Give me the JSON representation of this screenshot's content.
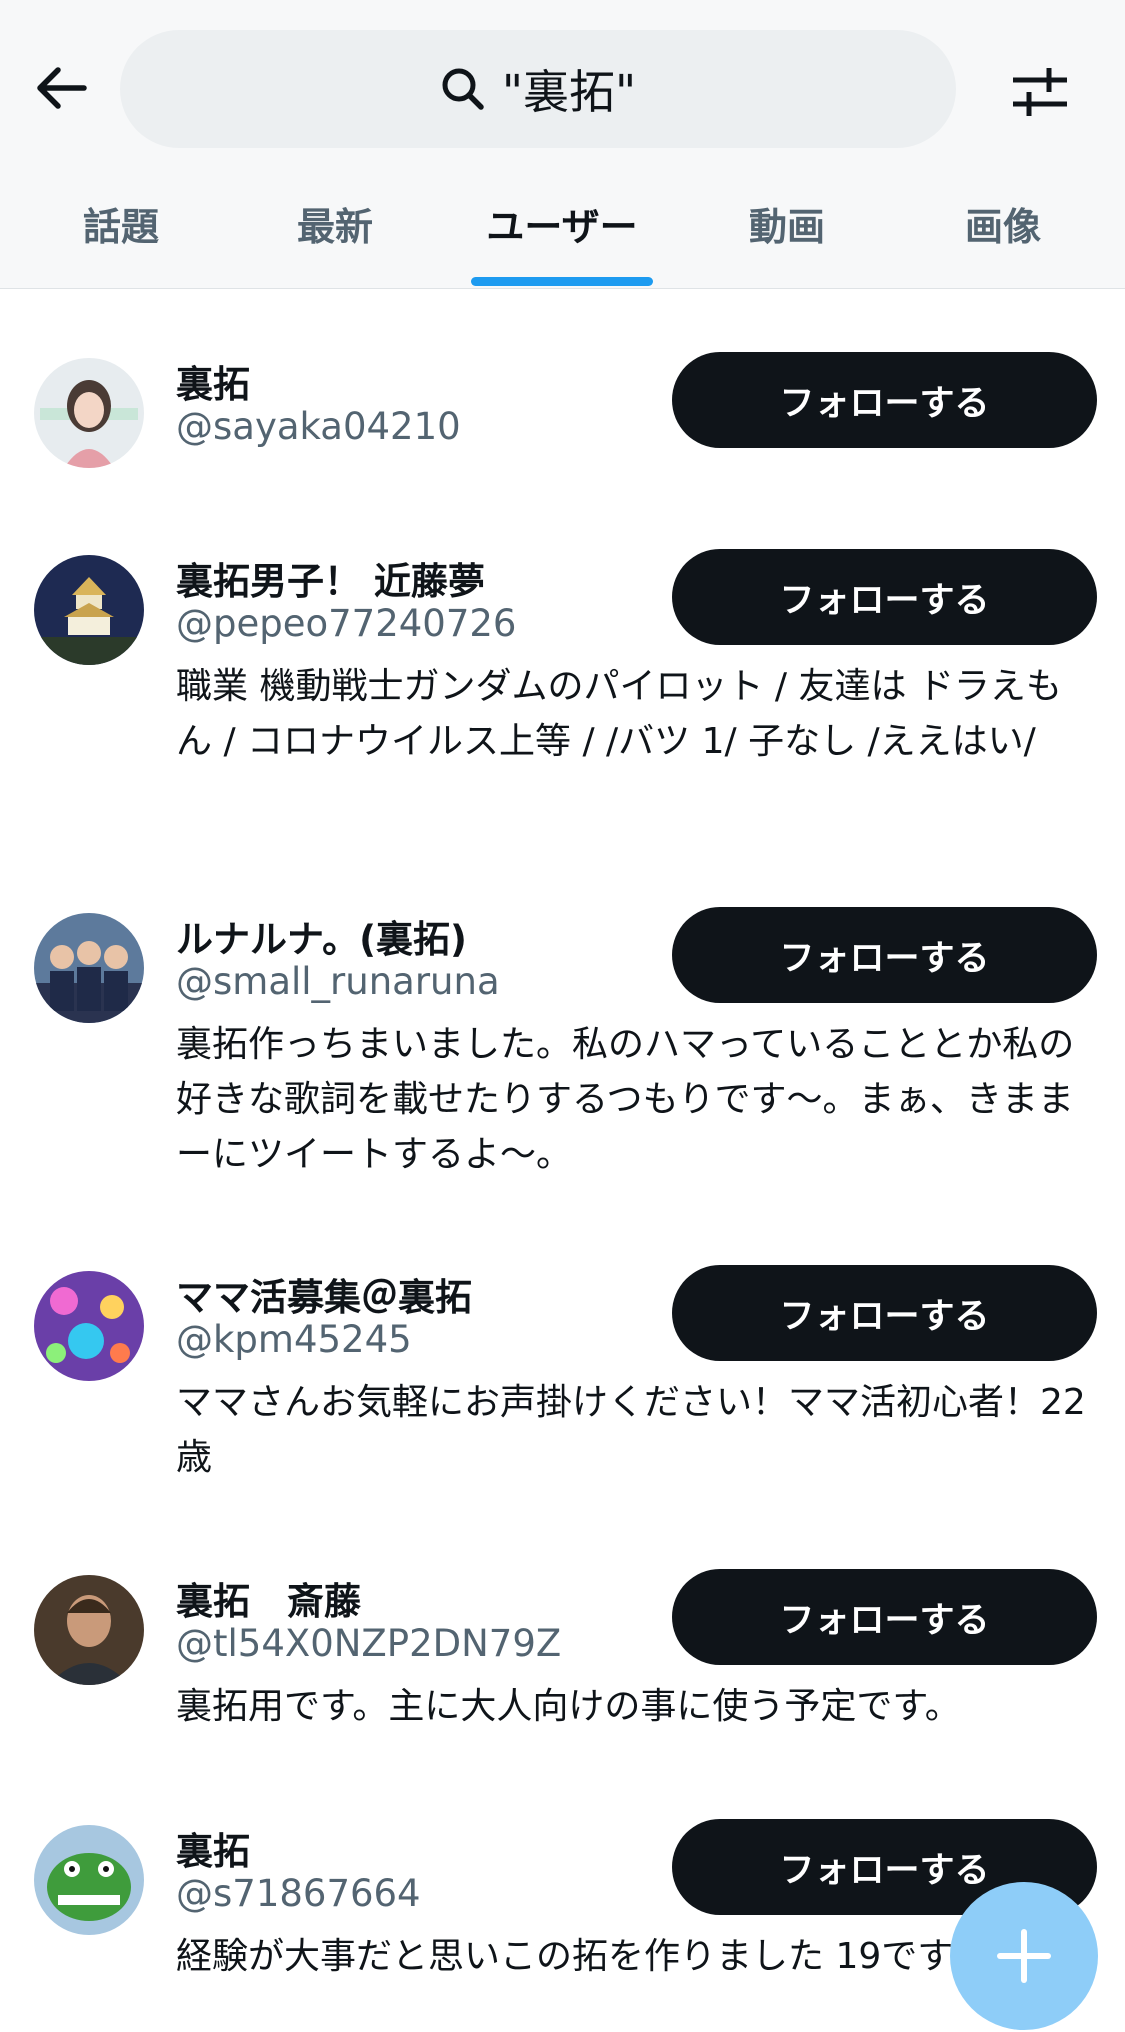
{
  "search": {
    "query": "\"裏拓\""
  },
  "tabs": [
    {
      "label": "話題"
    },
    {
      "label": "最新"
    },
    {
      "label": "ユーザー"
    },
    {
      "label": "動画"
    },
    {
      "label": "画像"
    }
  ],
  "active_tab": "ユーザー",
  "follow_label": "フォローする",
  "users": [
    {
      "name": "裏拓",
      "handle": "@sayaka04210",
      "bio": ""
    },
    {
      "name": "裏拓男子！ 近藤夢",
      "handle": "@pepeo77240726",
      "bio": "職業 機動戦士ガンダムのパイロット / 友達は ドラえもん / コロナウイルス上等 / /バツ 1/ 子なし /ええはい/"
    },
    {
      "name": "ルナルナ。(裏拓)",
      "handle": "@small_runaruna",
      "bio": "裏拓作っちまいました。私のハマっていることとか私の好きな歌詞を載せたりするつもりです〜。まぁ、きままーにツイートするよ〜。"
    },
    {
      "name": "ママ活募集＠裏拓",
      "handle": "@kpm45245",
      "bio": "ママさんお気軽にお声掛けください！ママ活初心者！22歳"
    },
    {
      "name": "裏拓　斎藤",
      "handle": "@tl54X0NZP2DN79Z",
      "bio": "裏拓用です。主に大人向けの事に使う予定です。"
    },
    {
      "name": "裏拓",
      "handle": "@s71867664",
      "bio": "経験が大事だと思いこの拓を作りました 19です"
    }
  ],
  "colors": {
    "accent": "#1d9bf0",
    "follow_button_bg": "#0f1419",
    "fab_bg": "#8ecdf8",
    "secondary_text": "#536471"
  },
  "icons": {
    "back": "arrow-left-icon",
    "search": "search-icon",
    "filter": "sliders-icon",
    "fab": "plus-icon"
  }
}
